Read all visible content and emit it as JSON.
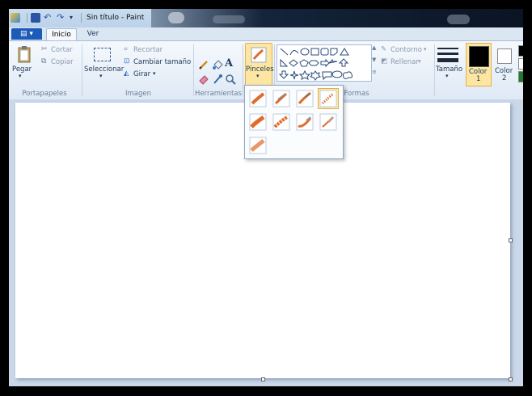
{
  "window": {
    "title": "Sin título - Paint"
  },
  "tabs": {
    "file_label": "▤ ▾",
    "home": "Inicio",
    "view": "Ver"
  },
  "ribbon": {
    "clipboard": {
      "paste": "Pegar",
      "cut": "Cortar",
      "copy": "Copiar",
      "group": "Portapapeles"
    },
    "image": {
      "select": "Seleccionar",
      "crop": "Recortar",
      "resize": "Cambiar tamaño",
      "rotate": "Girar",
      "group": "Imagen"
    },
    "tools": {
      "group": "Herramientas",
      "text_tool": "A"
    },
    "brushes": {
      "label": "Pinceles"
    },
    "shapes": {
      "outline": "Contorno",
      "fill": "Rellenar",
      "group": "Formas"
    },
    "size": {
      "label": "Tamaño"
    },
    "colors": {
      "color1": "Color",
      "color1_num": "1",
      "color2": "Color",
      "color2_num": "2",
      "color1_value": "#000000",
      "color2_value": "#ffffff"
    }
  },
  "brush_options": [
    "brush-icon",
    "calligraphy-brush-1-icon",
    "calligraphy-brush-2-icon",
    "airbrush-icon",
    "oil-brush-icon",
    "crayon-icon",
    "marker-icon",
    "natural-pencil-icon",
    "watercolor-brush-icon"
  ],
  "accent": "#1c5bb8"
}
